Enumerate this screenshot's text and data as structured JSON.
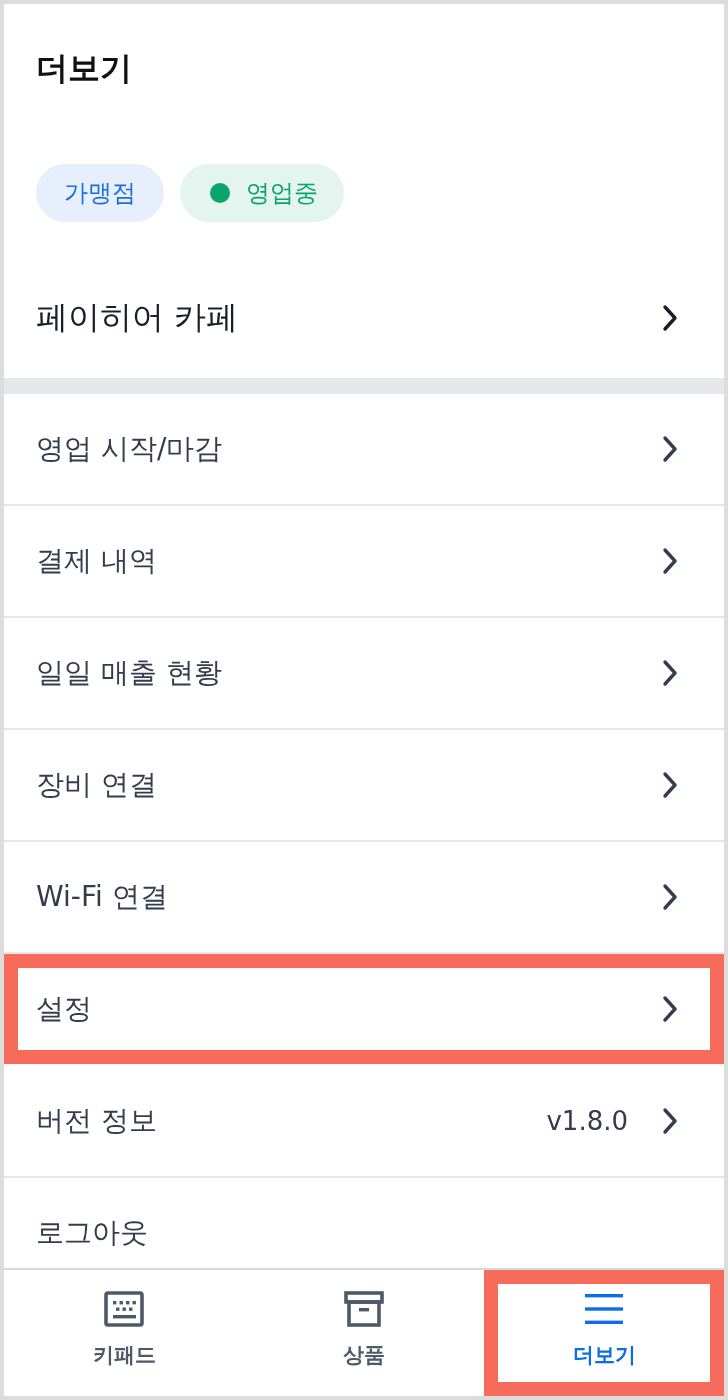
{
  "header": {
    "title": "더보기"
  },
  "badges": [
    {
      "kind": "tag",
      "label": "가맹점",
      "color": "#1b6fdb"
    },
    {
      "kind": "status",
      "label": "영업중",
      "color": "#0aa56a"
    }
  ],
  "store": {
    "name": "페이히어 카페"
  },
  "menu": [
    {
      "label": "영업 시작/마감",
      "chevron": true,
      "highlighted": false
    },
    {
      "label": "결제 내역",
      "chevron": true,
      "highlighted": false
    },
    {
      "label": "일일 매출 현황",
      "chevron": true,
      "highlighted": false
    },
    {
      "label": "장비 연결",
      "chevron": true,
      "highlighted": false
    },
    {
      "label": "Wi-Fi 연결",
      "chevron": true,
      "highlighted": false
    },
    {
      "label": "설정",
      "chevron": true,
      "highlighted": true
    },
    {
      "label": "버전 정보",
      "value": "v1.8.0",
      "chevron": true,
      "highlighted": false
    },
    {
      "label": "로그아웃",
      "chevron": false,
      "highlighted": false
    }
  ],
  "bottom_nav": [
    {
      "kind": "keypad",
      "label": "키패드",
      "selected": false,
      "highlighted": false
    },
    {
      "kind": "products",
      "label": "상품",
      "selected": false,
      "highlighted": false
    },
    {
      "kind": "more",
      "label": "더보기",
      "selected": true,
      "highlighted": true
    }
  ]
}
